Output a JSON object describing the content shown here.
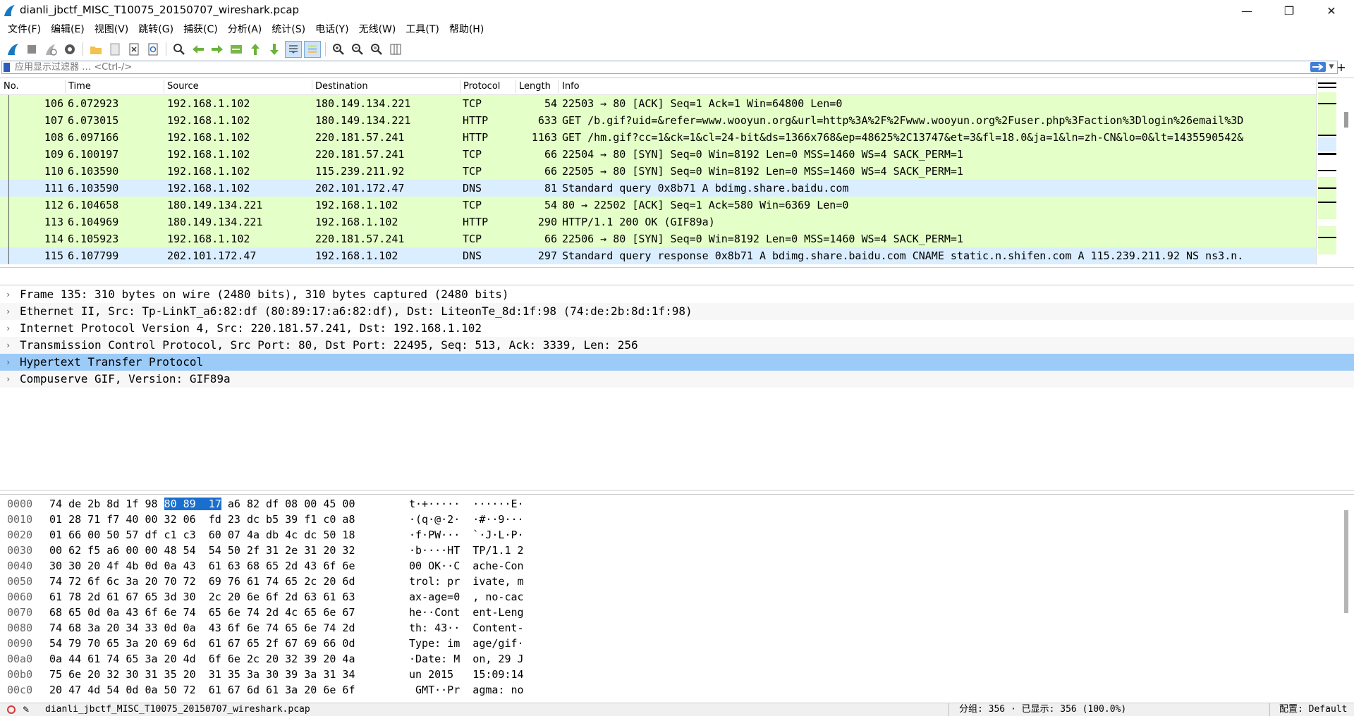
{
  "window": {
    "title": "dianli_jbctf_MISC_T10075_20150707_wireshark.pcap"
  },
  "menu": [
    "文件(F)",
    "编辑(E)",
    "视图(V)",
    "跳转(G)",
    "捕获(C)",
    "分析(A)",
    "统计(S)",
    "电话(Y)",
    "无线(W)",
    "工具(T)",
    "帮助(H)"
  ],
  "toolbar_icons": [
    "shark-fin-start-icon",
    "stop-icon",
    "restart-icon",
    "options-gear-icon",
    "open-folder-icon",
    "save-file-icon",
    "close-file-icon",
    "reload-icon",
    "find-magnifier-icon",
    "go-back-arrow-icon",
    "go-forward-arrow-icon",
    "go-to-packet-icon",
    "first-packet-icon",
    "last-packet-icon",
    "auto-scroll-icon",
    "colorize-icon",
    "zoom-in-icon",
    "zoom-out-icon",
    "normal-size-icon",
    "resize-columns-icon"
  ],
  "filter": {
    "placeholder": "应用显示过滤器 … <Ctrl-/>"
  },
  "packet_list": {
    "columns": [
      "No.",
      "Time",
      "Source",
      "Destination",
      "Protocol",
      "Length",
      "Info"
    ],
    "rows": [
      {
        "no": "106",
        "time": "6.072923",
        "src": "192.168.1.102",
        "dst": "180.149.134.221",
        "proto": "TCP",
        "len": "54",
        "info": "22503 → 80 [ACK] Seq=1 Ack=1 Win=64800 Len=0",
        "color": "#e4ffc7"
      },
      {
        "no": "107",
        "time": "6.073015",
        "src": "192.168.1.102",
        "dst": "180.149.134.221",
        "proto": "HTTP",
        "len": "633",
        "info": "GET /b.gif?uid=&refer=www.wooyun.org&url=http%3A%2F%2Fwww.wooyun.org%2Fuser.php%3Faction%3Dlogin%26email%3D",
        "color": "#e4ffc7"
      },
      {
        "no": "108",
        "time": "6.097166",
        "src": "192.168.1.102",
        "dst": "220.181.57.241",
        "proto": "HTTP",
        "len": "1163",
        "info": "GET /hm.gif?cc=1&ck=1&cl=24-bit&ds=1366x768&ep=48625%2C13747&et=3&fl=18.0&ja=1&ln=zh-CN&lo=0&lt=1435590542&",
        "color": "#e4ffc7"
      },
      {
        "no": "109",
        "time": "6.100197",
        "src": "192.168.1.102",
        "dst": "220.181.57.241",
        "proto": "TCP",
        "len": "66",
        "info": "22504 → 80 [SYN] Seq=0 Win=8192 Len=0 MSS=1460 WS=4 SACK_PERM=1",
        "color": "#e4ffc7"
      },
      {
        "no": "110",
        "time": "6.103590",
        "src": "192.168.1.102",
        "dst": "115.239.211.92",
        "proto": "TCP",
        "len": "66",
        "info": "22505 → 80 [SYN] Seq=0 Win=8192 Len=0 MSS=1460 WS=4 SACK_PERM=1",
        "color": "#e4ffc7"
      },
      {
        "no": "111",
        "time": "6.103590",
        "src": "192.168.1.102",
        "dst": "202.101.172.47",
        "proto": "DNS",
        "len": "81",
        "info": "Standard query 0x8b71 A bdimg.share.baidu.com",
        "color": "#daeeff"
      },
      {
        "no": "112",
        "time": "6.104658",
        "src": "180.149.134.221",
        "dst": "192.168.1.102",
        "proto": "TCP",
        "len": "54",
        "info": "80 → 22502 [ACK] Seq=1 Ack=580 Win=6369 Len=0",
        "color": "#e4ffc7"
      },
      {
        "no": "113",
        "time": "6.104969",
        "src": "180.149.134.221",
        "dst": "192.168.1.102",
        "proto": "HTTP",
        "len": "290",
        "info": "HTTP/1.1 200 OK  (GIF89a)",
        "color": "#e4ffc7"
      },
      {
        "no": "114",
        "time": "6.105923",
        "src": "192.168.1.102",
        "dst": "220.181.57.241",
        "proto": "TCP",
        "len": "66",
        "info": "22506 → 80 [SYN] Seq=0 Win=8192 Len=0 MSS=1460 WS=4 SACK_PERM=1",
        "color": "#e4ffc7"
      },
      {
        "no": "115",
        "time": "6.107799",
        "src": "202.101.172.47",
        "dst": "192.168.1.102",
        "proto": "DNS",
        "len": "297",
        "info": "Standard query response 0x8b71 A bdimg.share.baidu.com CNAME static.n.shifen.com A 115.239.211.92 NS ns3.n.",
        "color": "#daeeff"
      }
    ]
  },
  "details": [
    "Frame 135: 310 bytes on wire (2480 bits), 310 bytes captured (2480 bits)",
    "Ethernet II, Src: Tp-LinkT_a6:82:df (80:89:17:a6:82:df), Dst: LiteonTe_8d:1f:98 (74:de:2b:8d:1f:98)",
    "Internet Protocol Version 4, Src: 220.181.57.241, Dst: 192.168.1.102",
    "Transmission Control Protocol, Src Port: 80, Dst Port: 22495, Seq: 513, Ack: 3339, Len: 256",
    "Hypertext Transfer Protocol",
    "Compuserve GIF, Version: GIF89a"
  ],
  "bytes": [
    {
      "off": "0000",
      "hex": "74 de 2b 8d 1f 98 80 89  17 a6 82 df 08 00 45 00",
      "ascii": "t·+·····  ······E·"
    },
    {
      "off": "0010",
      "hex": "01 28 71 f7 40 00 32 06  fd 23 dc b5 39 f1 c0 a8",
      "ascii": "·(q·@·2·  ·#··9···"
    },
    {
      "off": "0020",
      "hex": "01 66 00 50 57 df c1 c3  60 07 4a db 4c dc 50 18",
      "ascii": "·f·PW···  `·J·L·P·"
    },
    {
      "off": "0030",
      "hex": "00 62 f5 a6 00 00 48 54  54 50 2f 31 2e 31 20 32",
      "ascii": "·b····HT  TP/1.1 2"
    },
    {
      "off": "0040",
      "hex": "30 30 20 4f 4b 0d 0a 43  61 63 68 65 2d 43 6f 6e",
      "ascii": "00 OK··C  ache-Con"
    },
    {
      "off": "0050",
      "hex": "74 72 6f 6c 3a 20 70 72  69 76 61 74 65 2c 20 6d",
      "ascii": "trol: pr  ivate, m"
    },
    {
      "off": "0060",
      "hex": "61 78 2d 61 67 65 3d 30  2c 20 6e 6f 2d 63 61 63",
      "ascii": "ax-age=0  , no-cac"
    },
    {
      "off": "0070",
      "hex": "68 65 0d 0a 43 6f 6e 74  65 6e 74 2d 4c 65 6e 67",
      "ascii": "he··Cont  ent-Leng"
    },
    {
      "off": "0080",
      "hex": "74 68 3a 20 34 33 0d 0a  43 6f 6e 74 65 6e 74 2d",
      "ascii": "th: 43··  Content-"
    },
    {
      "off": "0090",
      "hex": "54 79 70 65 3a 20 69 6d  61 67 65 2f 67 69 66 0d",
      "ascii": "Type: im  age/gif·"
    },
    {
      "off": "00a0",
      "hex": "0a 44 61 74 65 3a 20 4d  6f 6e 2c 20 32 39 20 4a",
      "ascii": "·Date: M  on, 29 J"
    },
    {
      "off": "00b0",
      "hex": "75 6e 20 32 30 31 35 20  31 35 3a 30 39 3a 31 34",
      "ascii": "un 2015   15:09:14"
    },
    {
      "off": "00c0",
      "hex": "20 47 4d 54 0d 0a 50 72  61 67 6d 61 3a 20 6e 6f",
      "ascii": " GMT··Pr  agma: no"
    }
  ],
  "status": {
    "file": "dianli_jbctf_MISC_T10075_20150707_wireshark.pcap",
    "packets": "分组: 356 · 已显示: 356 (100.0%)",
    "profile": "配置: Default"
  },
  "colors": {
    "tcp_row": "#e4ffc7",
    "dns_row": "#daeeff",
    "selected": "#9ccbf7",
    "byte_highlight": "#1a6fce"
  }
}
